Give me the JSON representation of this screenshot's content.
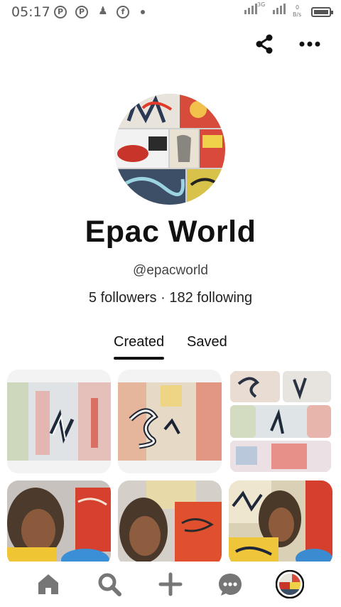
{
  "status_bar": {
    "time": "05:17",
    "network_type": "3G",
    "data_rate": "0",
    "data_unit": "B/s",
    "icons": [
      "pinterest-icon",
      "pinterest-icon",
      "person-icon",
      "facebook-icon",
      "notification-dot-icon",
      "signal-icon",
      "battery-icon"
    ]
  },
  "header": {
    "actions": [
      "share-icon",
      "more-icon"
    ]
  },
  "profile": {
    "name": "Epac World",
    "handle": "@epacworld",
    "followers_text": "5 followers",
    "separator": "·",
    "following_text": "182 following"
  },
  "tabs": [
    {
      "label": "Created",
      "active": true
    },
    {
      "label": "Saved",
      "active": false
    }
  ],
  "bottom_nav": {
    "items": [
      "home-icon",
      "search-icon",
      "plus-icon",
      "message-icon",
      "profile-avatar-icon"
    ]
  },
  "colors": {
    "text": "#111111",
    "muted": "#444444",
    "pin_background": "#f3f3f3"
  }
}
